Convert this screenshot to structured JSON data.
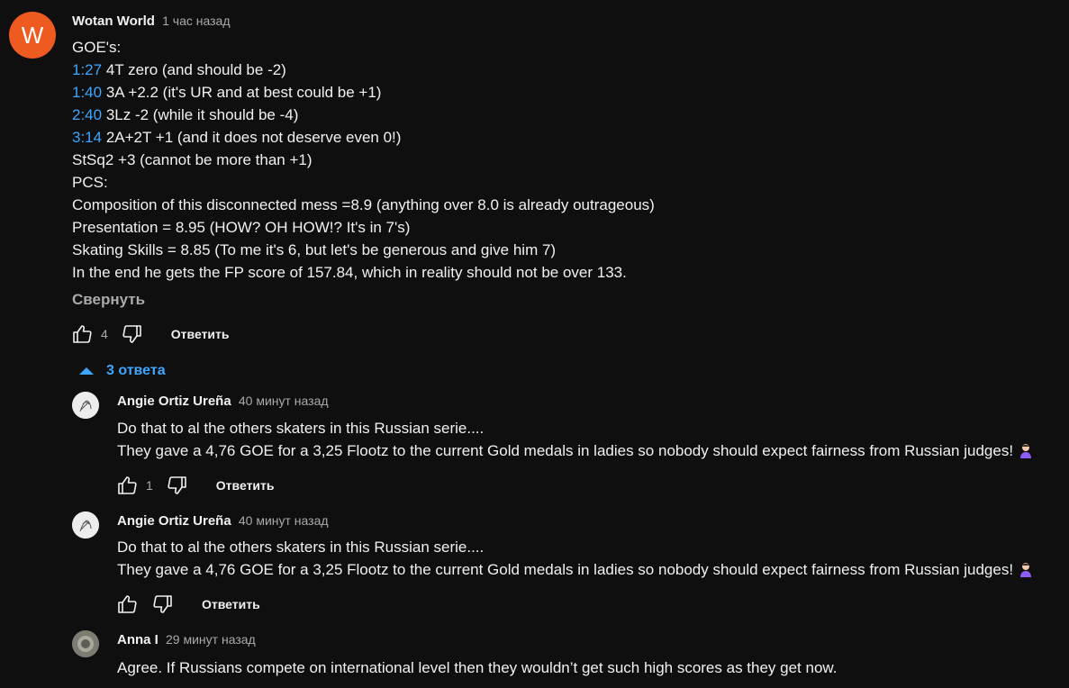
{
  "main_comment": {
    "avatar_letter": "W",
    "author": "Wotan World",
    "time": "1 час назад",
    "lines": [
      {
        "ts": "",
        "text": "GOE's:"
      },
      {
        "ts": "1:27",
        "text": " 4T  zero (and should be -2)"
      },
      {
        "ts": "1:40",
        "text": " 3A  +2.2 (it's UR and at best could be +1)"
      },
      {
        "ts": "2:40",
        "text": " 3Lz  -2 (while it should be -4)"
      },
      {
        "ts": "3:14",
        "text": " 2A+2T +1 (and it does not deserve even 0!)"
      },
      {
        "ts": "",
        "text": "StSq2 +3 (cannot be more than +1)"
      },
      {
        "ts": "",
        "text": "PCS:"
      },
      {
        "ts": "",
        "text": "Composition of this disconnected mess =8.9 (anything over 8.0 is already outrageous)"
      },
      {
        "ts": "",
        "text": "Presentation = 8.95 (HOW? OH HOW!? It's in 7's)"
      },
      {
        "ts": "",
        "text": "Skating Skills = 8.85 (To me it's 6, but let's be generous and give him 7)"
      },
      {
        "ts": "",
        "text": "In the end he gets the FP score of 157.84, which in reality should not be over 133."
      }
    ],
    "collapse_label": "Свернуть",
    "likes": "4",
    "reply_label": "Ответить"
  },
  "replies_toggle": {
    "label": "3 ответа"
  },
  "replies": [
    {
      "author": "Angie Ortiz Ureña",
      "time": "40 минут назад",
      "line1": "Do that to al the others skaters in this Russian serie....",
      "line2": "They gave a 4,76 GOE for a 3,25 Flootz to the current Gold medals in ladies so nobody should expect fairness from Russian judges!",
      "likes": "1",
      "reply_label": "Ответить"
    },
    {
      "author": "Angie Ortiz Ureña",
      "time": "40 минут назад",
      "line1": "Do that to al the others skaters in this Russian serie....",
      "line2": "They gave a 4,76 GOE for a 3,25 Flootz to the current Gold medals in ladies so nobody should expect fairness from Russian judges!",
      "likes": "",
      "reply_label": "Ответить"
    },
    {
      "author": "Anna I",
      "time": "29 минут назад",
      "line1": "Agree. If Russians compete on international level then they wouldn’t get such high scores as they get now."
    }
  ]
}
